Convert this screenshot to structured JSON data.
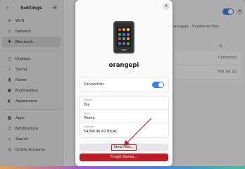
{
  "sidebar": {
    "title": "Settings",
    "items": [
      {
        "label": "Wi-Fi",
        "icon": "wifi-icon",
        "glyph": "≋"
      },
      {
        "label": "Network",
        "icon": "network-icon",
        "glyph": "▭"
      },
      {
        "label": "Bluetooth",
        "icon": "bluetooth-icon",
        "glyph": "✱",
        "active": true
      },
      {
        "label": "Displays",
        "icon": "display-icon",
        "glyph": "▢"
      },
      {
        "label": "Sound",
        "icon": "sound-icon",
        "glyph": "♪"
      },
      {
        "label": "Power",
        "icon": "power-icon",
        "glyph": "▮"
      },
      {
        "label": "Multitasking",
        "icon": "multitasking-icon",
        "glyph": "▣"
      },
      {
        "label": "Appearance",
        "icon": "appearance-icon",
        "glyph": "◐"
      },
      {
        "label": "Apps",
        "icon": "apps-icon",
        "glyph": "▦"
      },
      {
        "label": "Notifications",
        "icon": "bell-icon",
        "glyph": "♫"
      },
      {
        "label": "Search",
        "icon": "search-icon",
        "glyph": "⌕"
      },
      {
        "label": "Online Accounts",
        "icon": "accounts-icon",
        "glyph": "◎"
      }
    ]
  },
  "background": {
    "files_text": "orangepi\", Transferred files",
    "devices": [
      {
        "status": "Connected"
      },
      {
        "status": "Not Set Up"
      }
    ]
  },
  "dialog": {
    "device_name": "orangepi",
    "connection_label": "Connection",
    "connection_on": true,
    "info": [
      {
        "key": "Paired",
        "value": "Yes"
      },
      {
        "key": "Type",
        "value": "Phone"
      },
      {
        "key": "Address",
        "value": "54:B4:D6:47:B9:AC"
      }
    ],
    "send_files_label": "Send Files...",
    "forget_label": "Forget Device..."
  },
  "colors": {
    "accent": "#3584e4",
    "destructive": "#c01c28",
    "annotation": "#cc2222"
  }
}
